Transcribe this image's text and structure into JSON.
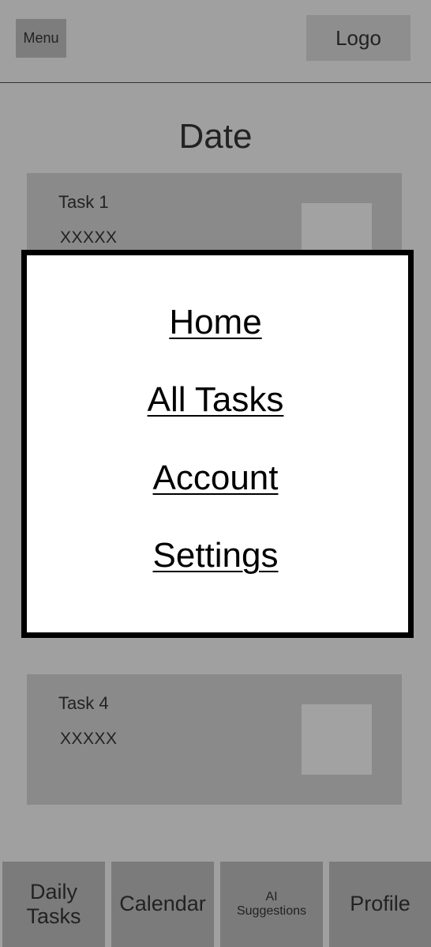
{
  "header": {
    "menu_label": "Menu",
    "logo_label": "Logo"
  },
  "date_title": "Date",
  "tasks": [
    {
      "title": "Task 1",
      "description": "XXXXX"
    },
    {
      "title": "Task 4",
      "description": "XXXXX"
    }
  ],
  "menu": {
    "items": [
      {
        "label": "Home"
      },
      {
        "label": "All Tasks"
      },
      {
        "label": "Account"
      },
      {
        "label": "Settings"
      }
    ]
  },
  "bottom_nav": {
    "tabs": [
      {
        "label": "Daily\nTasks"
      },
      {
        "label": "Calendar"
      },
      {
        "label": "AI\nSuggestions"
      },
      {
        "label": "Profile"
      }
    ]
  },
  "colors": {
    "background": "#a0a0a0",
    "card": "#8a8a8a",
    "nav_tab": "#7b7b7b",
    "menu_panel": "#ffffff",
    "menu_border": "#000000"
  }
}
